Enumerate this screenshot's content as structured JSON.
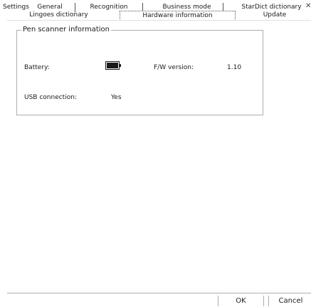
{
  "window": {
    "title": "Settings",
    "close_glyph": "✕"
  },
  "tabs": {
    "row1": [
      {
        "label": "General"
      },
      {
        "label": "Recognition"
      },
      {
        "label": "Business mode"
      },
      {
        "label": "StarDict dictionary"
      }
    ],
    "row2": [
      {
        "label": "Lingoes dictionary"
      },
      {
        "label": "Hardware information",
        "active": true
      },
      {
        "label": "Update"
      }
    ]
  },
  "pen_scanner": {
    "group_title": "Pen scanner information",
    "battery_label": "Battery:",
    "battery_icon": "battery-full-icon",
    "fw_label": "F/W version:",
    "fw_value": "1.10",
    "usb_label": "USB connection:",
    "usb_value": "Yes"
  },
  "buttons": {
    "ok": "OK",
    "cancel": "Cancel"
  }
}
